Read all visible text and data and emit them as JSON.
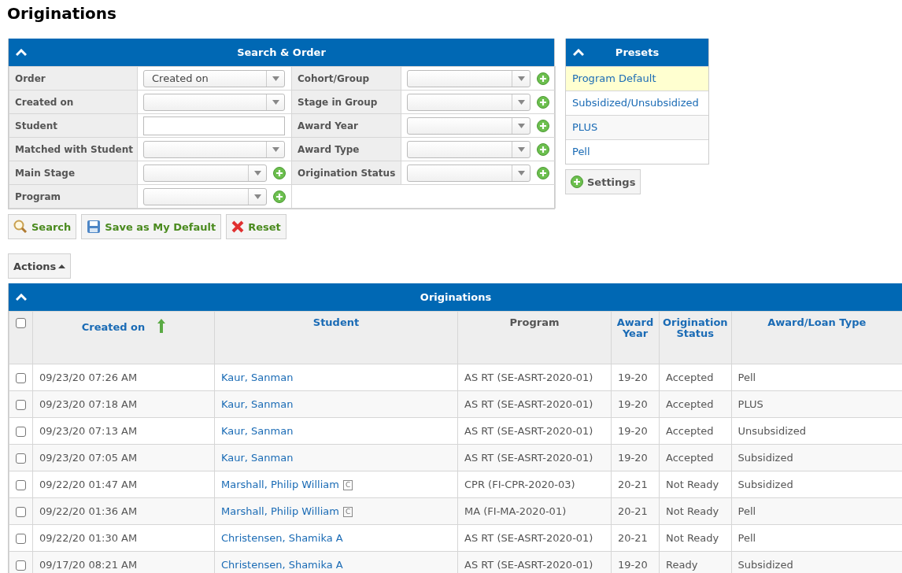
{
  "page_title": "Originations",
  "search_panel": {
    "title": "Search & Order",
    "left_fields": [
      {
        "label": "Order",
        "kind": "select",
        "value": "Created on",
        "add": false
      },
      {
        "label": "Created on",
        "kind": "select",
        "add": false
      },
      {
        "label": "Student",
        "kind": "text",
        "add": false
      },
      {
        "label": "Matched with Student",
        "kind": "select",
        "add": false
      },
      {
        "label": "Main Stage",
        "kind": "select",
        "add": true
      },
      {
        "label": "Program",
        "kind": "select",
        "add": true
      }
    ],
    "right_fields": [
      {
        "label": "Cohort/Group",
        "kind": "select",
        "add": true
      },
      {
        "label": "Stage in Group",
        "kind": "select",
        "add": true
      },
      {
        "label": "Award Year",
        "kind": "select",
        "add": true
      },
      {
        "label": "Award Type",
        "kind": "select",
        "add": true
      },
      {
        "label": "Origination Status",
        "kind": "select",
        "add": true
      }
    ]
  },
  "buttons": [
    {
      "label": "Search",
      "kind": "search"
    },
    {
      "label": "Save as My Default",
      "kind": "save"
    },
    {
      "label": "Reset",
      "kind": "reset"
    }
  ],
  "presets": {
    "title": "Presets",
    "items": [
      {
        "label": "Program Default",
        "selected": true
      },
      {
        "label": "Subsidized/Unsubsidized",
        "selected": false
      },
      {
        "label": "PLUS",
        "selected": false
      },
      {
        "label": "Pell",
        "selected": false
      }
    ],
    "settings_button": "Settings"
  },
  "actions_button": "Actions",
  "table": {
    "title": "Originations",
    "all_checked": false,
    "columns": [
      {
        "label": "Created on",
        "sortable": true,
        "sorted": true
      },
      {
        "label": "Student",
        "sortable": true,
        "sorted": false
      },
      {
        "label": "Program",
        "sortable": false,
        "sorted": false
      },
      {
        "label": "Award Year",
        "sortable": true,
        "sorted": false
      },
      {
        "label": "Origination Status",
        "sortable": true,
        "sorted": false
      },
      {
        "label": "Award/Loan Type",
        "sortable": true,
        "sorted": false
      }
    ],
    "rows": [
      {
        "checked": false,
        "created": "09/23/20 07:26 AM",
        "student": "Kaur, Sanman",
        "program": "AS RT (SE-ASRT-2020-01)",
        "year": "19-20",
        "status": "Accepted",
        "type": "Pell"
      },
      {
        "checked": false,
        "created": "09/23/20 07:18 AM",
        "student": "Kaur, Sanman",
        "program": "AS RT (SE-ASRT-2020-01)",
        "year": "19-20",
        "status": "Accepted",
        "type": "PLUS"
      },
      {
        "checked": false,
        "created": "09/23/20 07:13 AM",
        "student": "Kaur, Sanman",
        "program": "AS RT (SE-ASRT-2020-01)",
        "year": "19-20",
        "status": "Accepted",
        "type": "Unsubsidized"
      },
      {
        "checked": false,
        "created": "09/23/20 07:05 AM",
        "student": "Kaur, Sanman",
        "program": "AS RT (SE-ASRT-2020-01)",
        "year": "19-20",
        "status": "Accepted",
        "type": "Subsidized"
      },
      {
        "checked": false,
        "created": "09/22/20 01:47 AM",
        "student": "Marshall, Philip William",
        "badge": "C",
        "program": "CPR (FI-CPR-2020-03)",
        "year": "20-21",
        "status": "Not Ready",
        "type": "Subsidized"
      },
      {
        "checked": false,
        "created": "09/22/20 01:36 AM",
        "student": "Marshall, Philip William",
        "badge": "C",
        "program": "MA (FI-MA-2020-01)",
        "year": "20-21",
        "status": "Not Ready",
        "type": "Pell"
      },
      {
        "checked": false,
        "created": "09/22/20 01:30 AM",
        "student": "Christensen, Shamika A",
        "program": "AS RT (SE-ASRT-2020-01)",
        "year": "20-21",
        "status": "Not Ready",
        "type": "Pell"
      },
      {
        "checked": false,
        "created": "09/17/20 08:21 AM",
        "student": "Christensen, Shamika A",
        "program": "AS RT (SE-ASRT-2020-01)",
        "year": "19-20",
        "status": "Ready",
        "type": "Subsidized"
      }
    ]
  }
}
